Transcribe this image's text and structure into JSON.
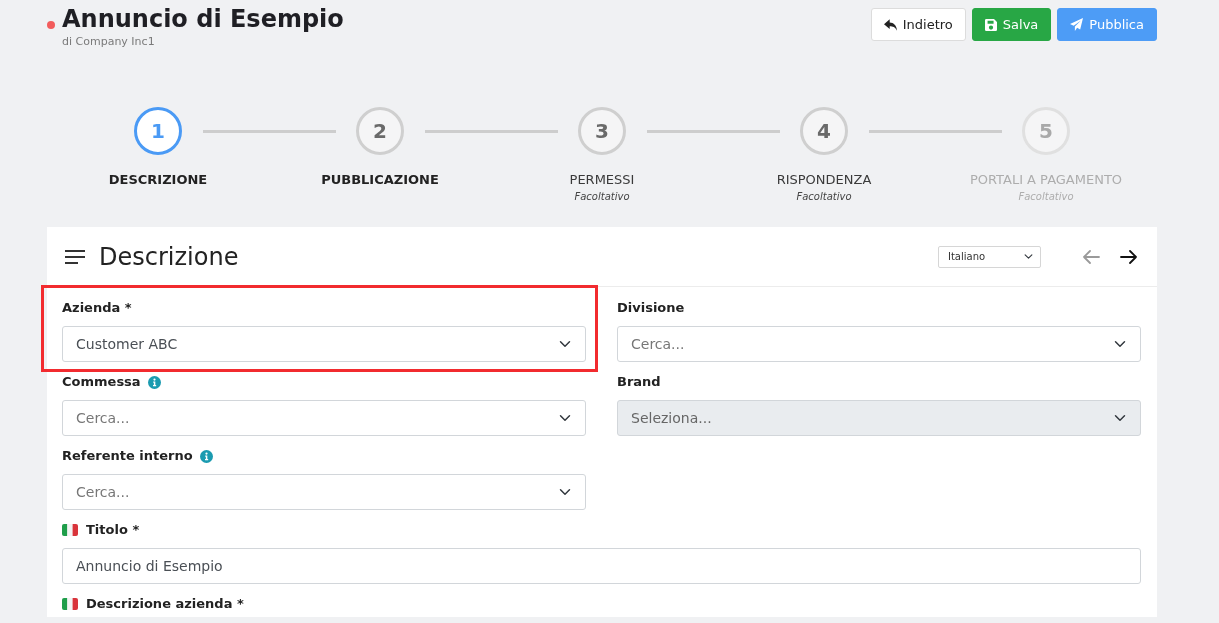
{
  "header": {
    "title": "Annuncio di Esempio",
    "subtitle": "di Company Inc1",
    "buttons": [
      {
        "kind": "back",
        "label": "Indietro"
      },
      {
        "kind": "save",
        "label": "Salva"
      },
      {
        "kind": "publish",
        "label": "Pubblica"
      }
    ]
  },
  "steps": [
    {
      "number": "1",
      "label": "DESCRIZIONE",
      "selected": true,
      "visited": true,
      "disabled": false
    },
    {
      "number": "2",
      "label": "PUBBLICAZIONE",
      "selected": false,
      "visited": true,
      "disabled": false
    },
    {
      "number": "3",
      "label": "PERMESSI",
      "note": "Facoltativo",
      "selected": false,
      "visited": false,
      "disabled": false
    },
    {
      "number": "4",
      "label": "RISPONDENZA",
      "note": "Facoltativo",
      "selected": false,
      "visited": false,
      "disabled": false
    },
    {
      "number": "5",
      "label": "PORTALI A PAGAMENTO",
      "note": "Facoltativo",
      "selected": false,
      "visited": false,
      "disabled": true
    }
  ],
  "card": {
    "title": "Descrizione",
    "language": "Italiano",
    "nav": [
      {
        "kind": "prev",
        "disabled": true
      },
      {
        "kind": "next",
        "disabled": false
      }
    ],
    "grid_rows": [
      {
        "fields": [
          {
            "label": "Azienda *",
            "kind": "select",
            "value": "Customer ABC",
            "info": false,
            "flag": false,
            "disabled": false,
            "highlighted": true
          },
          {
            "label": "Divisione",
            "kind": "select",
            "placeholder": "Cerca...",
            "info": false,
            "flag": false,
            "disabled": false,
            "highlighted": false
          }
        ]
      },
      {
        "fields": [
          {
            "label": "Commessa",
            "kind": "select",
            "placeholder": "Cerca...",
            "info": true,
            "flag": false,
            "disabled": false,
            "highlighted": false
          },
          {
            "label": "Brand",
            "kind": "select",
            "placeholder": "Seleziona...",
            "info": false,
            "flag": false,
            "disabled": true,
            "highlighted": false
          }
        ]
      },
      {
        "fields": [
          {
            "label": "Referente interno",
            "kind": "select",
            "placeholder": "Cerca...",
            "info": true,
            "flag": false,
            "disabled": false,
            "highlighted": false
          }
        ]
      }
    ],
    "wide_fields": [
      {
        "label": "Titolo *",
        "kind": "input",
        "value": "Annuncio di Esempio",
        "info": false,
        "flag": true,
        "disabled": false,
        "highlighted": false
      },
      {
        "label": "Descrizione azienda *",
        "info": false,
        "flag": true,
        "highlighted": false
      }
    ]
  }
}
